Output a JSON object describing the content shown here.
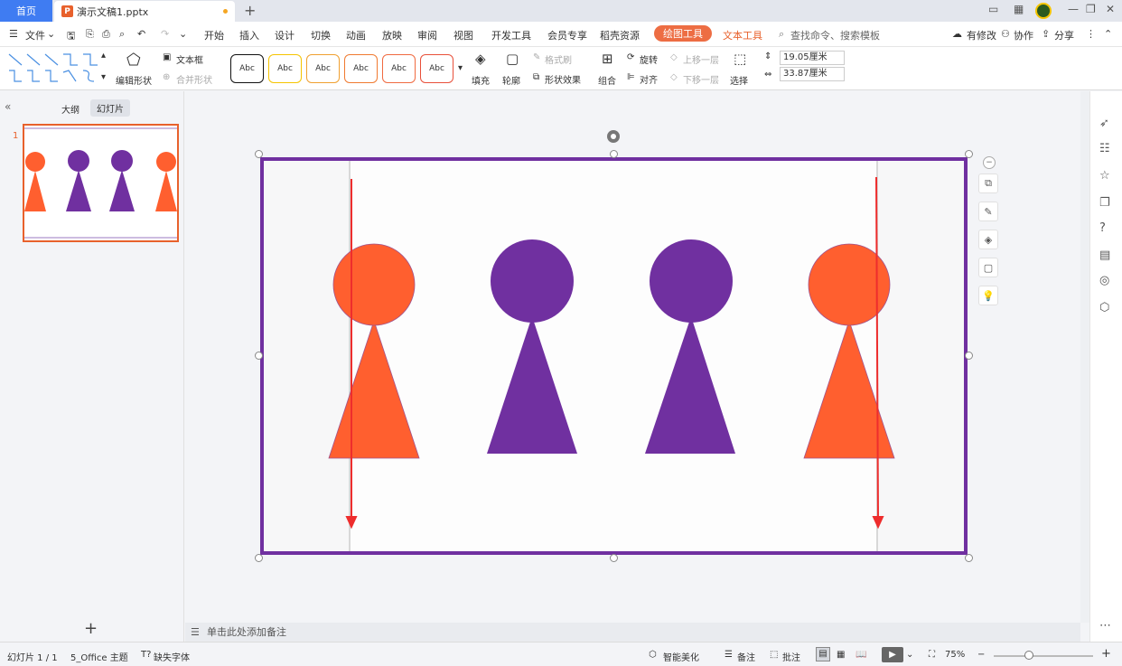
{
  "tabs": {
    "home": "首页",
    "doc": "演示文稿1.pptx",
    "add": "+"
  },
  "menu": {
    "file": "文件",
    "items": [
      "开始",
      "插入",
      "设计",
      "切换",
      "动画",
      "放映",
      "审阅",
      "视图",
      "开发工具",
      "会员专享",
      "稻壳资源"
    ],
    "active": "绘图工具",
    "text_tool": "文本工具",
    "search": "查找命令、搜索模板",
    "modified": "有修改",
    "collab": "协作",
    "share": "分享"
  },
  "ribbon": {
    "edit_shape": "编辑形状",
    "text_box": "文本框",
    "merge_shape": "合并形状",
    "style_label": "Abc",
    "fill": "填充",
    "outline": "轮廓",
    "format_painter": "格式刷",
    "shape_effect": "形状效果",
    "group": "组合",
    "rotate": "旋转",
    "align": "对齐",
    "bring_forward": "上移一层",
    "send_backward": "下移一层",
    "select": "选择",
    "height": "19.05厘米",
    "width": "33.87厘米"
  },
  "left_pane": {
    "outline_tab": "大纲",
    "slides_tab": "幻灯片",
    "slide_number": "1",
    "add": "+"
  },
  "notes": {
    "placeholder": "单击此处添加备注"
  },
  "status": {
    "slide_info": "幻灯片 1 / 1",
    "theme": "5_Office 主题",
    "missing_font": "缺失字体",
    "smart_beautify": "智能美化",
    "notes": "备注",
    "comments": "批注",
    "zoom": "75%"
  },
  "colors": {
    "accent": "#3f7cf2",
    "orange": "#ff5f2f",
    "purple": "#7030a0",
    "arrow": "#ee2d2d"
  }
}
